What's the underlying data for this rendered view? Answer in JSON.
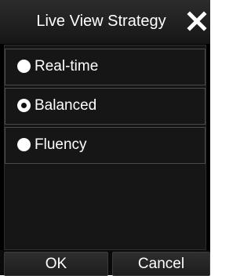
{
  "dialog": {
    "title": "Live View Strategy",
    "close_icon": "close-x-icon"
  },
  "options": [
    {
      "label": "Real-time",
      "selected": false
    },
    {
      "label": "Balanced",
      "selected": true
    },
    {
      "label": "Fluency",
      "selected": false
    }
  ],
  "buttons": {
    "ok_label": "OK",
    "cancel_label": "Cancel"
  },
  "colors": {
    "background": "#000000",
    "text": "#ffffff",
    "titlebar": "#1f1f1f"
  }
}
